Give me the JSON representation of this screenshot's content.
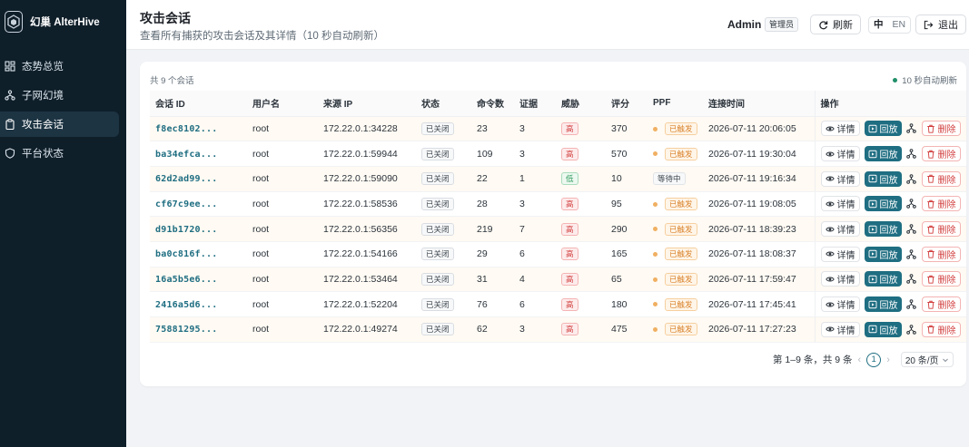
{
  "sidebar": {
    "brand": "幻巢 AlterHive",
    "items": [
      {
        "label": "态势总览",
        "icon": "dashboard-icon"
      },
      {
        "label": "子网幻境",
        "icon": "network-icon"
      },
      {
        "label": "攻击会话",
        "icon": "clipboard-icon",
        "active": true
      },
      {
        "label": "平台状态",
        "icon": "shield-icon"
      }
    ]
  },
  "header": {
    "title": "攻击会话",
    "subtitle": "查看所有捕获的攻击会话及其详情（10 秒自动刷新）",
    "user": "Admin",
    "role": "管理员",
    "refresh": "刷新",
    "lang_zh": "中",
    "lang_en": "EN",
    "logout": "退出"
  },
  "card": {
    "count": "共 9 个会话",
    "auto_refresh": "10 秒自动刷新"
  },
  "table": {
    "headers": [
      "会话 ID",
      "用户名",
      "来源 IP",
      "状态",
      "命令数",
      "证据",
      "威胁",
      "评分",
      "PPF",
      "连接时间",
      "操作"
    ],
    "action_labels": {
      "detail": "详情",
      "replay": "回放",
      "delete": "删除"
    },
    "rows": [
      {
        "id": "f8ec8102...",
        "user": "root",
        "ip": "172.22.0.1:34228",
        "status": "已关闭",
        "cmds": "23",
        "evidence": "3",
        "threat": "高",
        "score": "370",
        "ppf": "已触发",
        "time": "2026-07-11 20:06:05"
      },
      {
        "id": "ba34efca...",
        "user": "root",
        "ip": "172.22.0.1:59944",
        "status": "已关闭",
        "cmds": "109",
        "evidence": "3",
        "threat": "高",
        "score": "570",
        "ppf": "已触发",
        "time": "2026-07-11 19:30:04"
      },
      {
        "id": "62d2ad99...",
        "user": "root",
        "ip": "172.22.0.1:59090",
        "status": "已关闭",
        "cmds": "22",
        "evidence": "1",
        "threat": "低",
        "score": "10",
        "ppf": "等待中",
        "time": "2026-07-11 19:16:34"
      },
      {
        "id": "cf67c9ee...",
        "user": "root",
        "ip": "172.22.0.1:58536",
        "status": "已关闭",
        "cmds": "28",
        "evidence": "3",
        "threat": "高",
        "score": "95",
        "ppf": "已触发",
        "time": "2026-07-11 19:08:05"
      },
      {
        "id": "d91b1720...",
        "user": "root",
        "ip": "172.22.0.1:56356",
        "status": "已关闭",
        "cmds": "219",
        "evidence": "7",
        "threat": "高",
        "score": "290",
        "ppf": "已触发",
        "time": "2026-07-11 18:39:23"
      },
      {
        "id": "ba0c816f...",
        "user": "root",
        "ip": "172.22.0.1:54166",
        "status": "已关闭",
        "cmds": "29",
        "evidence": "6",
        "threat": "高",
        "score": "165",
        "ppf": "已触发",
        "time": "2026-07-11 18:08:37"
      },
      {
        "id": "16a5b5e6...",
        "user": "root",
        "ip": "172.22.0.1:53464",
        "status": "已关闭",
        "cmds": "31",
        "evidence": "4",
        "threat": "高",
        "score": "65",
        "ppf": "已触发",
        "time": "2026-07-11 17:59:47"
      },
      {
        "id": "2416a5d6...",
        "user": "root",
        "ip": "172.22.0.1:52204",
        "status": "已关闭",
        "cmds": "76",
        "evidence": "6",
        "threat": "高",
        "score": "180",
        "ppf": "已触发",
        "time": "2026-07-11 17:45:41"
      },
      {
        "id": "75881295...",
        "user": "root",
        "ip": "172.22.0.1:49274",
        "status": "已关闭",
        "cmds": "62",
        "evidence": "3",
        "threat": "高",
        "score": "475",
        "ppf": "已触发",
        "time": "2026-07-11 17:27:23"
      }
    ]
  },
  "pagination": {
    "summary": "第 1–9 条，共 9 条",
    "current": "1",
    "page_size": "20 条/页"
  },
  "colors": {
    "sidebar_bg": "#0f1f2a",
    "primary": "#1f6e82",
    "danger": "#d23d3d",
    "warning": "#d9822b",
    "success": "#2f9a5b"
  }
}
